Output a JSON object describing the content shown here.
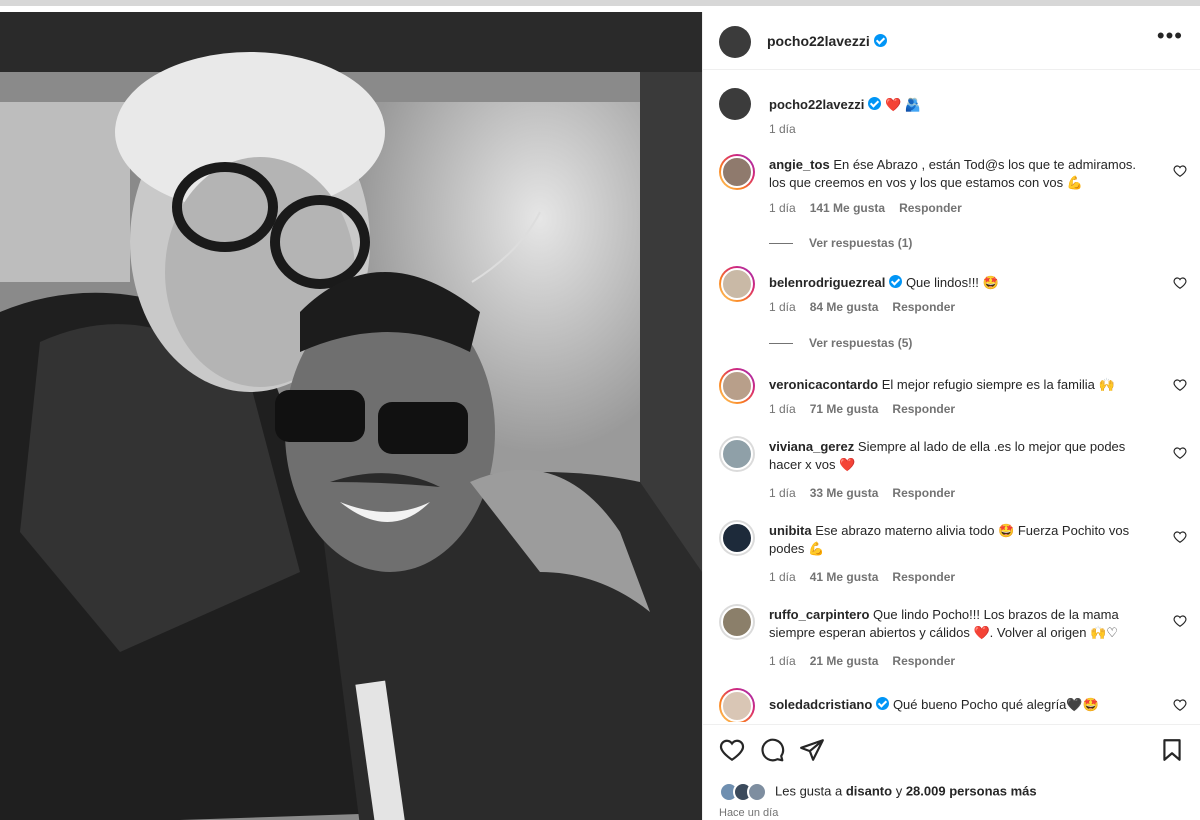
{
  "post": {
    "username": "pocho22lavezzi",
    "more_label": "•••",
    "caption_emoji": "❤️ 🫂",
    "caption_time": "1 día"
  },
  "comments": [
    {
      "user": "angie_tos",
      "text": "En ése Abrazo , están Tod@s los que te admiramos. los que creemos en vos y los que estamos con vos 💪",
      "time": "1 día",
      "likes": "141 Me gusta",
      "reply": "Responder",
      "view_replies": "Ver respuestas (1)"
    },
    {
      "user": "belenrodriguezreal",
      "verified": true,
      "text": "Que lindos!!! 🤩",
      "time": "1 día",
      "likes": "84 Me gusta",
      "reply": "Responder",
      "view_replies": "Ver respuestas (5)"
    },
    {
      "user": "veronicacontardo",
      "text": "El mejor refugio siempre es la familia 🙌",
      "time": "1 día",
      "likes": "71 Me gusta",
      "reply": "Responder"
    },
    {
      "user": "viviana_gerez",
      "text": "Siempre al lado de ella .es lo mejor que podes hacer x vos ❤️",
      "time": "1 día",
      "likes": "33 Me gusta",
      "reply": "Responder"
    },
    {
      "user": "unibita",
      "text": "Ese abrazo materno alivia todo 🤩 Fuerza Pochito vos podes 💪",
      "time": "1 día",
      "likes": "41 Me gusta",
      "reply": "Responder"
    },
    {
      "user": "ruffo_carpintero",
      "text": "Que lindo Pocho!!! Los brazos de la mama siempre esperan abiertos y cálidos ❤️. Volver al origen 🙌♡",
      "time": "1 día",
      "likes": "21 Me gusta",
      "reply": "Responder"
    },
    {
      "user": "soledadcristiano",
      "verified": true,
      "text": "Qué bueno Pocho qué alegría🖤🤩"
    }
  ],
  "footer": {
    "likes_prefix": "Les gusta a",
    "likes_user": "disanto",
    "likes_and": "y",
    "likes_count": "28.009 personas más",
    "time": "Hace un día"
  },
  "colors": {
    "accent": "#0095f6",
    "heart": "#ed4956"
  }
}
